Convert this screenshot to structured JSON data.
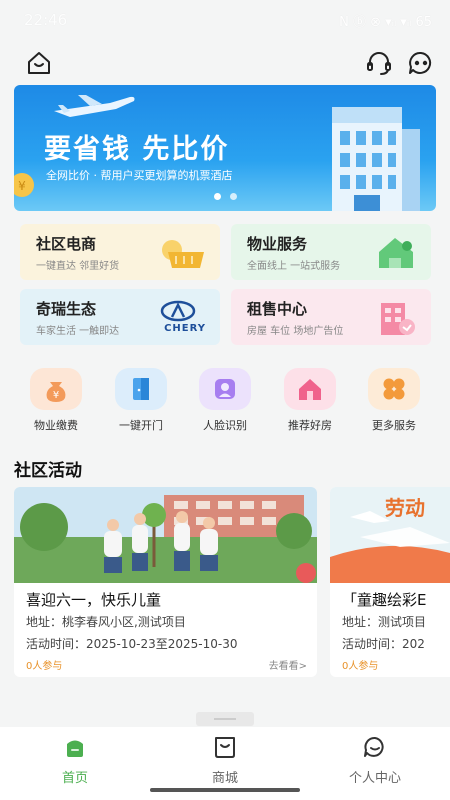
{
  "status_bar": {
    "time": "22:46",
    "system": "N ⓑ ⊗ ▾ᵢₗ ▾ᵢₗ 65"
  },
  "banner": {
    "title": "要省钱 先比价",
    "subtitle": "全网比价 · 帮用户买更划算的机票酒店",
    "page_count": 2
  },
  "feature_cards": [
    {
      "title": "社区电商",
      "subtitle": "一键直达  邻里好货",
      "icon": "shopping-basket-icon",
      "bg": "#fbf3dd"
    },
    {
      "title": "物业服务",
      "subtitle": "全面线上  一站式服务",
      "icon": "house-wrench-icon",
      "bg": "#e6f6ea"
    },
    {
      "title": "奇瑞生态",
      "subtitle": "车家生活  一触即达",
      "icon": "chery-logo",
      "logo_text": "CHERY",
      "bg": "#e3f2f8"
    },
    {
      "title": "租售中心",
      "subtitle": "房屋  车位  场地广告位",
      "icon": "building-icon",
      "bg": "#fbe8ee"
    }
  ],
  "quick_actions": [
    {
      "label": "物业缴费",
      "icon": "yen-bag-icon",
      "color": "#f7c9a7"
    },
    {
      "label": "一键开门",
      "icon": "door-icon",
      "color": "#cfe7fa"
    },
    {
      "label": "人脸识别",
      "icon": "face-scan-icon",
      "color": "#e4d6fb"
    },
    {
      "label": "推荐好房",
      "icon": "house-icon",
      "color": "#fbd3df"
    },
    {
      "label": "更多服务",
      "icon": "clover-icon",
      "color": "#fde3c8"
    }
  ],
  "section": {
    "title": "社区活动"
  },
  "activities": [
    {
      "title": "喜迎六一，快乐儿童",
      "address": "地址：桃李春风小区,测试项目",
      "time": "活动时间：2025-10-23至2025-10-30",
      "participants": "0人参与",
      "more": "去看看>"
    },
    {
      "title": "「童趣绘彩E",
      "address": "地址：测试项目",
      "time": "活动时间：202",
      "participants": "0人参与",
      "more": ""
    }
  ],
  "tabs": [
    {
      "label": "首页",
      "icon": "home-icon",
      "active": true
    },
    {
      "label": "商城",
      "icon": "shopping-bag-icon",
      "active": false
    },
    {
      "label": "个人中心",
      "icon": "profile-icon",
      "active": false
    }
  ],
  "colors": {
    "accent": "#4caf50",
    "tab_inactive": "#666666",
    "banner": "#1e8ae6"
  }
}
